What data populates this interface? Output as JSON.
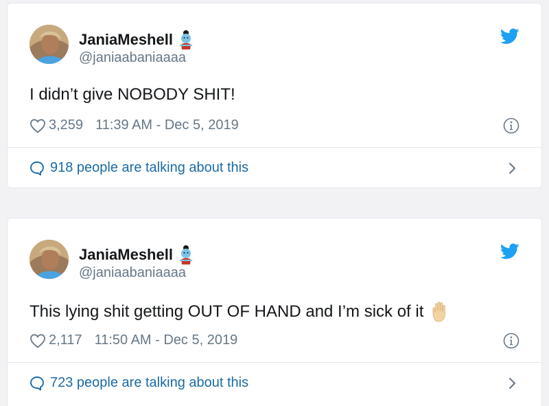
{
  "tweets": [
    {
      "name": "JaniaMeshell",
      "handle": "@janiaabaniaaaa",
      "text": "I didn’t give NOBODY SHIT!",
      "likes": "3,259",
      "timestamp": "11:39 AM - Dec 5, 2019",
      "talking": "918 people are talking about this"
    },
    {
      "name": "JaniaMeshell",
      "handle": "@janiaabaniaaaa",
      "text": "This lying shit getting OUT OF HAND and I’m sick of it",
      "likes": "2,117",
      "timestamp": "11:50 AM - Dec 5, 2019",
      "talking": "723 people are talking about this"
    }
  ],
  "icons": {
    "brand": "twitter-bird-icon",
    "heart": "heart-icon",
    "info": "info-icon",
    "bubble": "speech-bubble-icon",
    "chevron": "chevron-right-icon",
    "name_emoji": "genie-emoji",
    "text_emoji": "raised-hand-emoji"
  },
  "colors": {
    "twitter_blue": "#1da1f2",
    "link_blue": "#1b6aa5",
    "muted": "#657786",
    "text": "#14171a"
  }
}
